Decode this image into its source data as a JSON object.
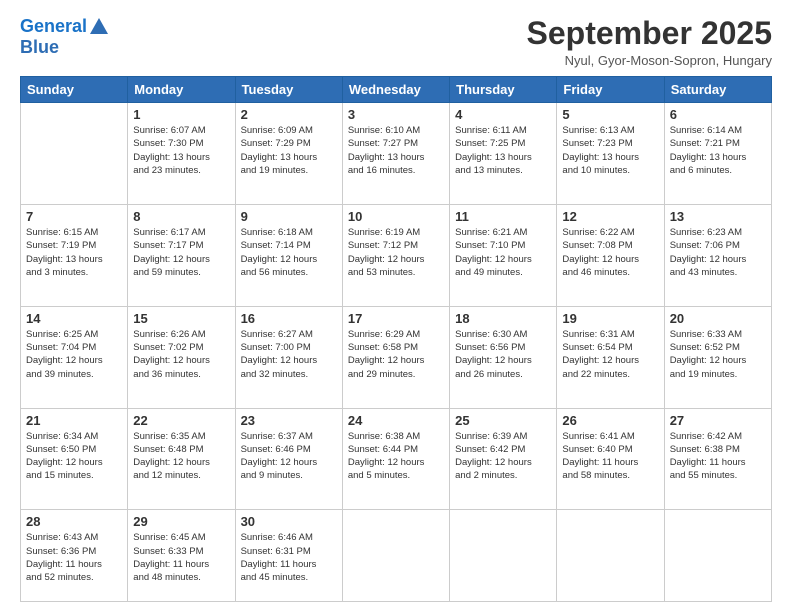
{
  "header": {
    "logo_line1": "General",
    "logo_line2": "Blue",
    "title": "September 2025",
    "subtitle": "Nyul, Gyor-Moson-Sopron, Hungary"
  },
  "weekdays": [
    "Sunday",
    "Monday",
    "Tuesday",
    "Wednesday",
    "Thursday",
    "Friday",
    "Saturday"
  ],
  "weeks": [
    [
      {
        "day": "",
        "info": ""
      },
      {
        "day": "1",
        "info": "Sunrise: 6:07 AM\nSunset: 7:30 PM\nDaylight: 13 hours\nand 23 minutes."
      },
      {
        "day": "2",
        "info": "Sunrise: 6:09 AM\nSunset: 7:29 PM\nDaylight: 13 hours\nand 19 minutes."
      },
      {
        "day": "3",
        "info": "Sunrise: 6:10 AM\nSunset: 7:27 PM\nDaylight: 13 hours\nand 16 minutes."
      },
      {
        "day": "4",
        "info": "Sunrise: 6:11 AM\nSunset: 7:25 PM\nDaylight: 13 hours\nand 13 minutes."
      },
      {
        "day": "5",
        "info": "Sunrise: 6:13 AM\nSunset: 7:23 PM\nDaylight: 13 hours\nand 10 minutes."
      },
      {
        "day": "6",
        "info": "Sunrise: 6:14 AM\nSunset: 7:21 PM\nDaylight: 13 hours\nand 6 minutes."
      }
    ],
    [
      {
        "day": "7",
        "info": "Sunrise: 6:15 AM\nSunset: 7:19 PM\nDaylight: 13 hours\nand 3 minutes."
      },
      {
        "day": "8",
        "info": "Sunrise: 6:17 AM\nSunset: 7:17 PM\nDaylight: 12 hours\nand 59 minutes."
      },
      {
        "day": "9",
        "info": "Sunrise: 6:18 AM\nSunset: 7:14 PM\nDaylight: 12 hours\nand 56 minutes."
      },
      {
        "day": "10",
        "info": "Sunrise: 6:19 AM\nSunset: 7:12 PM\nDaylight: 12 hours\nand 53 minutes."
      },
      {
        "day": "11",
        "info": "Sunrise: 6:21 AM\nSunset: 7:10 PM\nDaylight: 12 hours\nand 49 minutes."
      },
      {
        "day": "12",
        "info": "Sunrise: 6:22 AM\nSunset: 7:08 PM\nDaylight: 12 hours\nand 46 minutes."
      },
      {
        "day": "13",
        "info": "Sunrise: 6:23 AM\nSunset: 7:06 PM\nDaylight: 12 hours\nand 43 minutes."
      }
    ],
    [
      {
        "day": "14",
        "info": "Sunrise: 6:25 AM\nSunset: 7:04 PM\nDaylight: 12 hours\nand 39 minutes."
      },
      {
        "day": "15",
        "info": "Sunrise: 6:26 AM\nSunset: 7:02 PM\nDaylight: 12 hours\nand 36 minutes."
      },
      {
        "day": "16",
        "info": "Sunrise: 6:27 AM\nSunset: 7:00 PM\nDaylight: 12 hours\nand 32 minutes."
      },
      {
        "day": "17",
        "info": "Sunrise: 6:29 AM\nSunset: 6:58 PM\nDaylight: 12 hours\nand 29 minutes."
      },
      {
        "day": "18",
        "info": "Sunrise: 6:30 AM\nSunset: 6:56 PM\nDaylight: 12 hours\nand 26 minutes."
      },
      {
        "day": "19",
        "info": "Sunrise: 6:31 AM\nSunset: 6:54 PM\nDaylight: 12 hours\nand 22 minutes."
      },
      {
        "day": "20",
        "info": "Sunrise: 6:33 AM\nSunset: 6:52 PM\nDaylight: 12 hours\nand 19 minutes."
      }
    ],
    [
      {
        "day": "21",
        "info": "Sunrise: 6:34 AM\nSunset: 6:50 PM\nDaylight: 12 hours\nand 15 minutes."
      },
      {
        "day": "22",
        "info": "Sunrise: 6:35 AM\nSunset: 6:48 PM\nDaylight: 12 hours\nand 12 minutes."
      },
      {
        "day": "23",
        "info": "Sunrise: 6:37 AM\nSunset: 6:46 PM\nDaylight: 12 hours\nand 9 minutes."
      },
      {
        "day": "24",
        "info": "Sunrise: 6:38 AM\nSunset: 6:44 PM\nDaylight: 12 hours\nand 5 minutes."
      },
      {
        "day": "25",
        "info": "Sunrise: 6:39 AM\nSunset: 6:42 PM\nDaylight: 12 hours\nand 2 minutes."
      },
      {
        "day": "26",
        "info": "Sunrise: 6:41 AM\nSunset: 6:40 PM\nDaylight: 11 hours\nand 58 minutes."
      },
      {
        "day": "27",
        "info": "Sunrise: 6:42 AM\nSunset: 6:38 PM\nDaylight: 11 hours\nand 55 minutes."
      }
    ],
    [
      {
        "day": "28",
        "info": "Sunrise: 6:43 AM\nSunset: 6:36 PM\nDaylight: 11 hours\nand 52 minutes."
      },
      {
        "day": "29",
        "info": "Sunrise: 6:45 AM\nSunset: 6:33 PM\nDaylight: 11 hours\nand 48 minutes."
      },
      {
        "day": "30",
        "info": "Sunrise: 6:46 AM\nSunset: 6:31 PM\nDaylight: 11 hours\nand 45 minutes."
      },
      {
        "day": "",
        "info": ""
      },
      {
        "day": "",
        "info": ""
      },
      {
        "day": "",
        "info": ""
      },
      {
        "day": "",
        "info": ""
      }
    ]
  ]
}
